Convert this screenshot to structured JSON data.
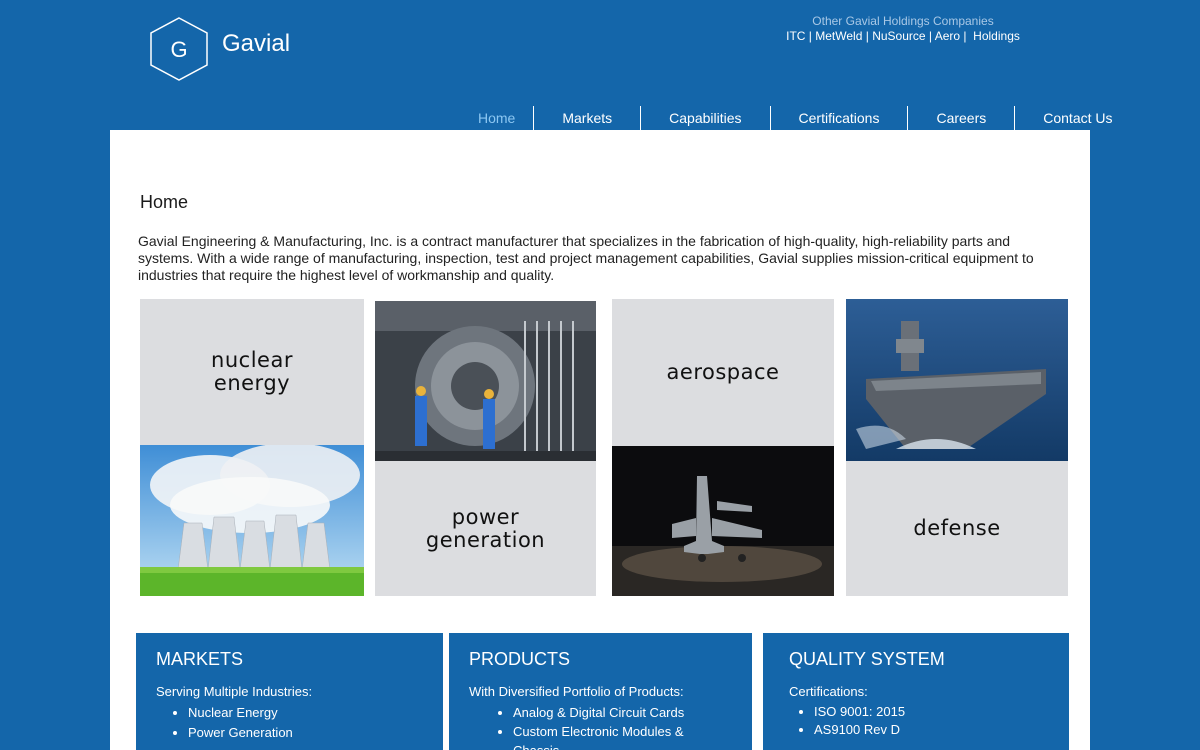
{
  "header": {
    "logo_letter": "G",
    "brand": "Gavial",
    "other_companies_title": "Other Gavial Holdings Companies",
    "other_companies": [
      "ITC",
      "MetWeld",
      "NuSource",
      "Aero",
      "Holdings"
    ]
  },
  "nav": {
    "items": [
      {
        "label": "Home"
      },
      {
        "label": "Markets"
      },
      {
        "label": "Capabilities"
      },
      {
        "label": "Certifications"
      },
      {
        "label": "Careers"
      },
      {
        "label": "Contact Us"
      }
    ]
  },
  "main": {
    "title": "Home",
    "intro": "Gavial Engineering & Manufacturing, Inc. is a contract manufacturer that specializes in the fabrication of high-quality, high-reliability parts and systems.  With a wide range of manufacturing, inspection, test and project management capabilities, Gavial supplies mission-critical equipment to industries that require the highest level of workmanship and quality.",
    "tiles": {
      "nuclear": "nuclear\nenergy",
      "power": "power\ngeneration",
      "aerospace": "aerospace",
      "defense": "defense"
    }
  },
  "cards": {
    "markets": {
      "title": "MARKETS",
      "subtitle": "Serving Multiple Industries:",
      "items": [
        "Nuclear Energy",
        "Power Generation"
      ]
    },
    "products": {
      "title": "PRODUCTS",
      "subtitle": "With Diversified Portfolio of Products:",
      "items": [
        "Analog & Digital Circuit Cards",
        "Custom Electronic Modules & Chassis"
      ]
    },
    "quality": {
      "title": "QUALITY SYSTEM",
      "subtitle": "Certifications:",
      "items": [
        "ISO 9001: 2015",
        "AS9100 Rev D"
      ]
    }
  },
  "colors": {
    "background": "#1466aa",
    "nav_active": "#8cc7f2",
    "tile_grey": "#dcdde0"
  }
}
